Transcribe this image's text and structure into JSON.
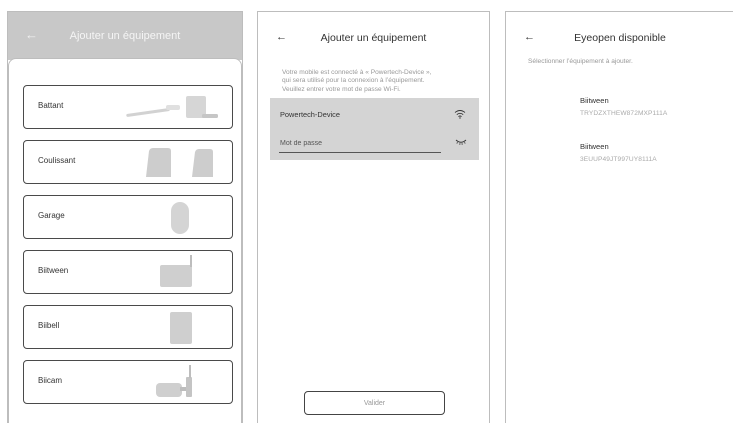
{
  "screen1": {
    "back_icon": "arrow-left-icon",
    "title": "Ajouter un équipement",
    "devices": [
      {
        "label": "Battant",
        "icon": "swing-gate-motor-icon"
      },
      {
        "label": "Coulissant",
        "icon": "sliding-gate-motor-icon"
      },
      {
        "label": "Garage",
        "icon": "garage-motor-icon"
      },
      {
        "label": "Biitween",
        "icon": "biitween-device-icon"
      },
      {
        "label": "Biibell",
        "icon": "biibell-device-icon"
      },
      {
        "label": "Biicam",
        "icon": "biicam-device-icon"
      }
    ]
  },
  "screen2": {
    "back_icon": "arrow-left-icon",
    "title": "Ajouter un équipement",
    "description_lines": [
      "Votre mobile est connecté à « Powertech-Device »,",
      "qui sera utilisé pour la connexion à l’équipement.",
      "Veuillez entrer votre mot de passe Wi-Fi."
    ],
    "network_name": "Powertech-Device",
    "password_placeholder": "Mot de passe",
    "wifi_icon": "wifi-icon",
    "visibility_icon": "eye-closed-icon",
    "validate_label": "Valider"
  },
  "screen3": {
    "back_icon": "arrow-left-icon",
    "title": "Eyeopen disponible",
    "hint": "Sélectionner l’équipement à ajouter.",
    "devices": [
      {
        "name": "Biitween",
        "serial": "TRYDZXTHEW872MXP111A"
      },
      {
        "name": "Biitween",
        "serial": "3EUUP49JT997UY8111A"
      }
    ]
  },
  "colors": {
    "header_gray": "#c8c8c8",
    "field_gray": "#d4d4d4",
    "muted_text": "#999999"
  }
}
